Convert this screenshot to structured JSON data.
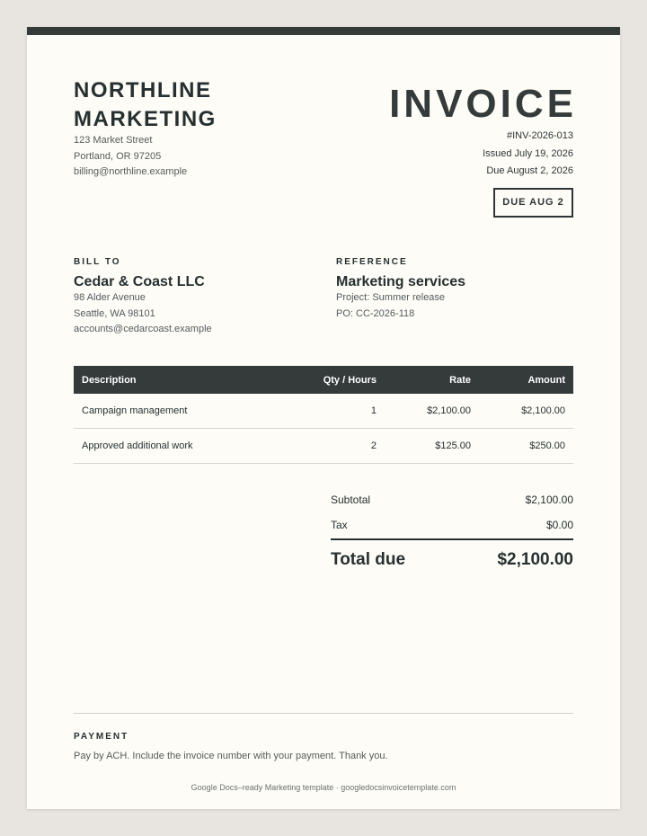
{
  "company": {
    "name": "NORTHLINE MARKETING",
    "address": [
      "123 Market Street",
      "Portland, OR 97205",
      "billing@northline.example"
    ]
  },
  "invoice": {
    "title": "INVOICE",
    "number": "#INV-2026-013",
    "issued": "Issued July 19, 2026",
    "due": "Due August 2, 2026",
    "due_badge": "DUE AUG 2"
  },
  "bill_to": {
    "label": "BILL TO",
    "name": "Cedar & Coast LLC",
    "lines": [
      "98 Alder Avenue",
      "Seattle, WA 98101",
      "accounts@cedarcoast.example"
    ]
  },
  "reference": {
    "label": "REFERENCE",
    "title": "Marketing services",
    "lines": [
      "Project: Summer release",
      "PO: CC-2026-118"
    ]
  },
  "table": {
    "headers": [
      "Description",
      "Qty / Hours",
      "Rate",
      "Amount"
    ],
    "rows": [
      [
        "Campaign management",
        "1",
        "$2,100.00",
        "$2,100.00"
      ],
      [
        "Approved additional work",
        "2",
        "$125.00",
        "$250.00"
      ]
    ]
  },
  "totals": {
    "subtotal_label": "Subtotal",
    "subtotal_value": "$2,100.00",
    "tax_label": "Tax",
    "tax_value": "$0.00",
    "total_label": "Total due",
    "total_value": "$2,100.00"
  },
  "payment": {
    "label": "PAYMENT",
    "note": "Pay by ACH. Include the invoice number with your payment. Thank you."
  },
  "footer": {
    "credit": "Google Docs–ready Marketing template · googledocsinvoicetemplate.com"
  }
}
